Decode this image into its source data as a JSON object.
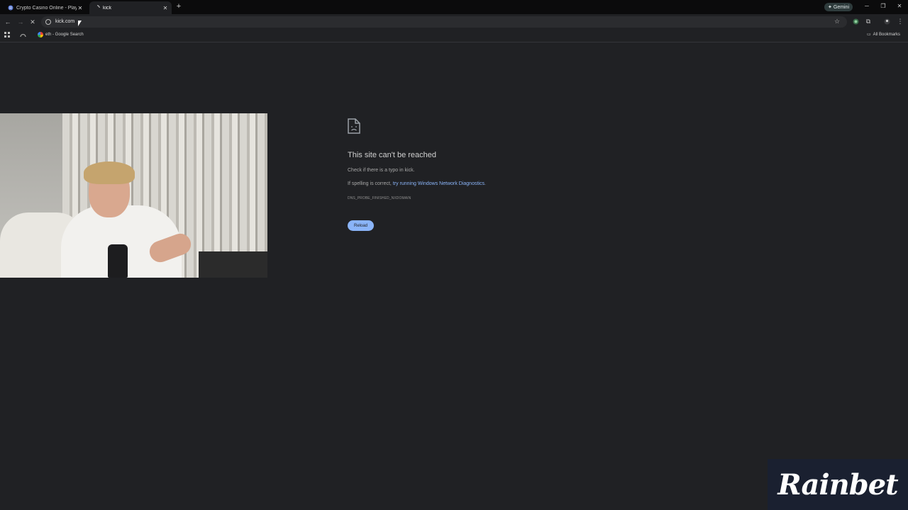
{
  "browser": {
    "tabs": [
      {
        "title": "Crypto Casino Online - Play wit",
        "active": false
      },
      {
        "title": "kick",
        "active": true
      }
    ],
    "gemini_label": "Gemini",
    "address": "kick.com",
    "bookmarks": [
      {
        "label": "eth - Google Search"
      }
    ],
    "all_bookmarks_label": "All Bookmarks"
  },
  "error_page": {
    "title": "This site can't be reached",
    "line1": "Check if there is a typo in kick.",
    "line2_prefix": "If spelling is correct, ",
    "line2_link": "try running Windows Network Diagnostics",
    "line2_suffix": ".",
    "error_code": "DNS_PROBE_FINISHED_NXDOMAIN",
    "reload_label": "Reload"
  },
  "overlay": {
    "sponsor_logo": "Rainbet"
  },
  "colors": {
    "background": "#202124",
    "link": "#8ab4f8",
    "tabstrip": "#0b0b0c"
  }
}
